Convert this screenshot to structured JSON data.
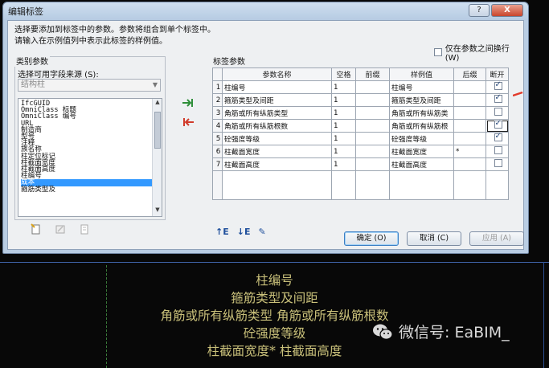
{
  "dialog": {
    "title": "编辑标签",
    "description_line1": "选择要添加到标签中的参数。参数将组合到单个标签中。",
    "description_line2": "请输入在示例值列中表示此标签的样例值。",
    "wrap_option_label": "仅在参数之间换行 (W)",
    "wrap_option_checked": false
  },
  "category": {
    "group_label": "类别参数",
    "source_label": "选择可用字段来源 (S):",
    "source_value": "结构柱",
    "items": [
      "IfcGUID",
      "OmniClass 标题",
      "OmniClass 编号",
      "URL",
      "制造商",
      "型号",
      "注释",
      "族名称",
      "柱定位标记",
      "柱截面宽度",
      "柱截面高度",
      "柱编号",
      "成本",
      "箍筋类型及"
    ],
    "selected_index": 12
  },
  "params": {
    "group_label": "标签参数",
    "headers": [
      "参数名称",
      "空格",
      "前缀",
      "样例值",
      "后缀",
      "断开"
    ],
    "rows": [
      {
        "num": "1",
        "name": "柱编号",
        "space": "1",
        "prefix": "",
        "sample": "柱编号",
        "suffix": "",
        "break": true
      },
      {
        "num": "2",
        "name": "箍筋类型及间距",
        "space": "1",
        "prefix": "",
        "sample": "箍筋类型及间距",
        "suffix": "",
        "break": true
      },
      {
        "num": "3",
        "name": "角筋或所有纵筋类型",
        "space": "1",
        "prefix": "",
        "sample": "角筋或所有纵筋类",
        "suffix": "",
        "break": false
      },
      {
        "num": "4",
        "name": "角筋或所有纵筋根数",
        "space": "1",
        "prefix": "",
        "sample": "角筋或所有纵筋根",
        "suffix": "",
        "break": true
      },
      {
        "num": "5",
        "name": "砼强度等级",
        "space": "1",
        "prefix": "",
        "sample": "砼强度等级",
        "suffix": "",
        "break": true
      },
      {
        "num": "6",
        "name": "柱截面宽度",
        "space": "1",
        "prefix": "",
        "sample": "柱截面宽度",
        "suffix": "*",
        "break": false
      },
      {
        "num": "7",
        "name": "柱截面高度",
        "space": "1",
        "prefix": "",
        "sample": "柱截面高度",
        "suffix": "",
        "break": false
      }
    ]
  },
  "buttons": {
    "ok": "确定 (O)",
    "cancel": "取消 (C)",
    "apply": "应用 (A)"
  },
  "titlebar": {
    "help": "?",
    "close": "X"
  },
  "canvas": {
    "tag_lines": [
      "柱编号",
      "箍筋类型及间距",
      "角筋或所有纵筋类型 角筋或所有纵筋根数",
      "砼强度等级",
      "柱截面宽度* 柱截面高度"
    ],
    "watermark": "微信号: EaBIM_"
  },
  "colors": {
    "tag_text": "#c9c07a",
    "selection": "#3399ff",
    "dialog_frame": "#b9cde3"
  }
}
